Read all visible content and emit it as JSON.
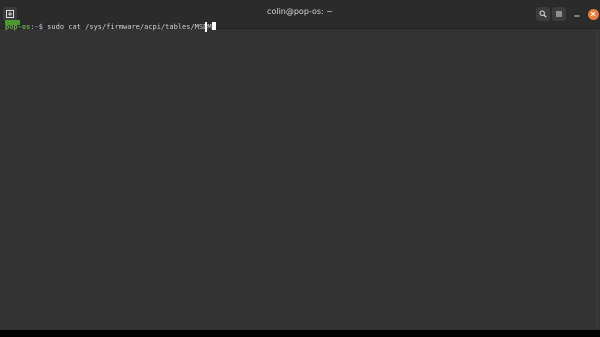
{
  "window": {
    "title": "colin@pop-os: ~"
  },
  "terminal": {
    "prompt_user": "pop-os",
    "prompt_sep": ":",
    "prompt_path": "~",
    "prompt_symbol": "$ ",
    "command": "sudo cat /sys/firmware/acpi/tables/MSDM"
  },
  "icons": {
    "new_tab": "new-tab-icon",
    "search": "search-icon",
    "menu": "hamburger-menu-icon",
    "minimize": "minimize-icon",
    "close": "close-icon"
  },
  "colors": {
    "background": "#333333",
    "titlebar": "#2b2b2b",
    "prompt_user": "#6aa84f",
    "prompt_path": "#4f8fd8",
    "close_button": "#e57e3c"
  }
}
